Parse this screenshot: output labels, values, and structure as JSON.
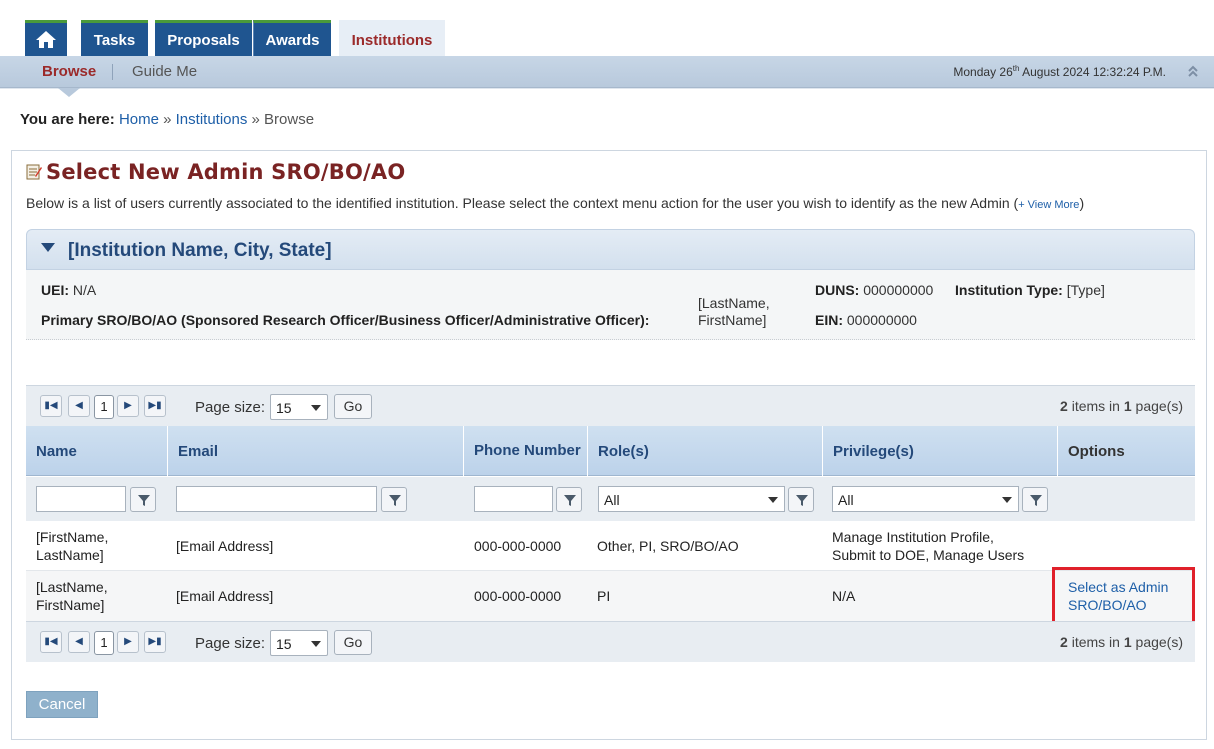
{
  "tabs": {
    "tasks": "Tasks",
    "proposals": "Proposals",
    "awards": "Awards",
    "institutions": "Institutions"
  },
  "subnav": {
    "browse": "Browse",
    "guide": "Guide Me",
    "date_prefix": "Monday 26",
    "date_sup": "th",
    "date_suffix": " August 2024 12:32:24 P.M."
  },
  "breadcrumb": {
    "label": "You are here:",
    "home": "Home",
    "sep1": "»",
    "institutions": "Institutions",
    "sep2": "»",
    "current": "Browse"
  },
  "page": {
    "title": "Select New Admin SRO/BO/AO",
    "description": "Below is a list of users currently associated to the identified institution. Please select the context menu action for the user you wish to identify as the new Admin (",
    "view_more": "+ View More",
    "desc_close": ")"
  },
  "institution": {
    "name": "[Institution Name, City, State]",
    "uei_label": "UEI:",
    "uei_value": "N/A",
    "primary_label": "Primary SRO/BO/AO (Sponsored Research Officer/Business Officer/Administrative Officer):",
    "primary_value_1": "[LastName,",
    "primary_value_2": "FirstName]",
    "duns_label": "DUNS:",
    "duns_value": "000000000",
    "type_label": "Institution Type:",
    "type_value": "[Type]",
    "ein_label": "EIN:",
    "ein_value": "000000000"
  },
  "pager": {
    "page": "1",
    "page_size_label": "Page size:",
    "page_size": "15",
    "go": "Go",
    "items_count": "2",
    "items_text": " items in ",
    "pages_count": "1",
    "pages_text": " page(s)"
  },
  "grid": {
    "columns": [
      "Name",
      "Email",
      "Phone Number",
      "Role(s)",
      "Privilege(s)",
      "Options"
    ],
    "filter_role": "All",
    "filter_priv": "All",
    "rows": [
      {
        "name_1": "[FirstName,",
        "name_2": "LastName]",
        "email": "[Email Address]",
        "phone": "000-000-0000",
        "roles": "Other, PI, SRO/BO/AO",
        "priv_1": "Manage Institution Profile,",
        "priv_2": "Submit to DOE, Manage Users",
        "option_1": "",
        "option_2": ""
      },
      {
        "name_1": "[LastName,",
        "name_2": "FirstName]",
        "email": "[Email Address]",
        "phone": "000-000-0000",
        "roles": "PI",
        "priv_1": "N/A",
        "priv_2": "",
        "option_1": "Select as Admin",
        "option_2": "SRO/BO/AO"
      }
    ]
  },
  "buttons": {
    "cancel": "Cancel"
  },
  "colors": {
    "tab_blue": "#1f5590",
    "accent_red": "#9b2a2a",
    "highlight": "#e0202a",
    "link": "#1e5fa8"
  },
  "icons": [
    "home-icon",
    "edit-note-icon",
    "collapse-up-icon",
    "first-page-icon",
    "prev-page-icon",
    "next-page-icon",
    "last-page-icon",
    "filter-icon",
    "dropdown-caret-icon"
  ]
}
